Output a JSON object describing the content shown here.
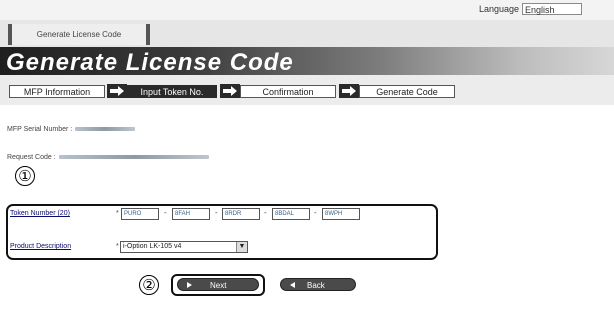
{
  "header": {
    "language_label": "Language",
    "language_value": "English"
  },
  "tab": {
    "label": "Generate License Code"
  },
  "page_title": "Generate License Code",
  "steps": [
    "MFP Information",
    "Input Token No.",
    "Confirmation",
    "Generate Code"
  ],
  "info": {
    "serial_label": "MFP Serial Number :",
    "request_label": "Request Code :"
  },
  "annotations": {
    "one": "①",
    "two": "②"
  },
  "form": {
    "token_label": "Token Number (20)",
    "token_required": "*",
    "token_values": [
      "PURO",
      "8FAH",
      "8RDR",
      "8BDAL",
      "8WPH"
    ],
    "product_label": "Product Description",
    "product_required": "*",
    "product_value": "i-Option LK-105 v4"
  },
  "buttons": {
    "next": "Next",
    "back": "Back"
  }
}
